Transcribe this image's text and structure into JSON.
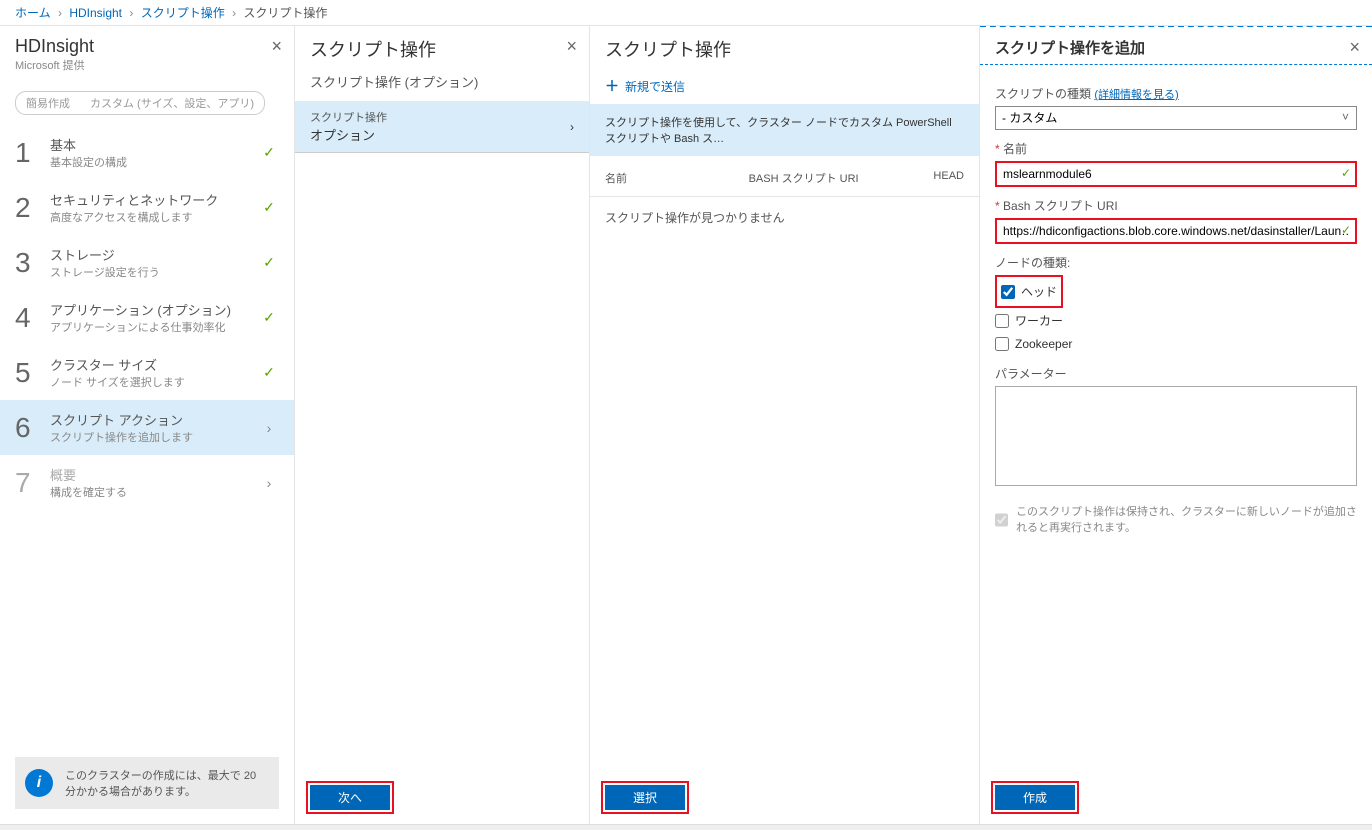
{
  "breadcrumb": {
    "items": [
      "ホーム",
      "HDInsight",
      "スクリプト操作"
    ],
    "last": "スクリプト操作"
  },
  "blade1": {
    "title": "HDInsight",
    "subtitle": "Microsoft 提供",
    "pill_left": "簡易作成",
    "pill_right": "カスタム (サイズ、設定、アプリ)",
    "steps": [
      {
        "num": "1",
        "title": "基本",
        "desc": "基本設定の構成",
        "status": "✓"
      },
      {
        "num": "2",
        "title": "セキュリティとネットワーク",
        "desc": "高度なアクセスを構成します",
        "status": "✓"
      },
      {
        "num": "3",
        "title": "ストレージ",
        "desc": "ストレージ設定を行う",
        "status": "✓"
      },
      {
        "num": "4",
        "title": "アプリケーション (オプション)",
        "desc": "アプリケーションによる仕事効率化",
        "status": "✓"
      },
      {
        "num": "5",
        "title": "クラスター サイズ",
        "desc": "ノード サイズを選択します",
        "status": "✓"
      },
      {
        "num": "6",
        "title": "スクリプト アクション",
        "desc": "スクリプト操作を追加します",
        "status": "›"
      },
      {
        "num": "7",
        "title": "概要",
        "desc": "構成を確定する",
        "status": "›"
      }
    ],
    "info": "このクラスターの作成には、最大で 20 分かかる場合があります。"
  },
  "blade2": {
    "title": "スクリプト操作",
    "section": "スクリプト操作 (オプション)",
    "option_title": "スクリプト操作",
    "option_value": "オプション",
    "button": "次へ"
  },
  "blade3": {
    "title": "スクリプト操作",
    "submit": "新規で送信",
    "banner": "スクリプト操作を使用して、クラスター ノードでカスタム PowerShell スクリプトや Bash ス…",
    "cols": {
      "c1": "名前",
      "c2": "BASH スクリプト URI",
      "c3": "HEAD"
    },
    "empty": "スクリプト操作が見つかりません",
    "button": "選択"
  },
  "blade4": {
    "title": "スクリプト操作を追加",
    "type_label": "スクリプトの種類",
    "type_link": "(詳細情報を見る)",
    "type_value": "- カスタム",
    "name_label": "名前",
    "name_value": "mslearnmodule6",
    "uri_label": "Bash スクリプト URI",
    "uri_value": "https://hdiconfigactions.blob.core.windows.net/dasinstaller/Laun…",
    "node_label": "ノードの種類:",
    "cb_head": "ヘッド",
    "cb_worker": "ワーカー",
    "cb_zk": "Zookeeper",
    "param_label": "パラメーター",
    "persist": "このスクリプト操作は保持され、クラスターに新しいノードが追加されると再実行されます。",
    "button": "作成"
  }
}
